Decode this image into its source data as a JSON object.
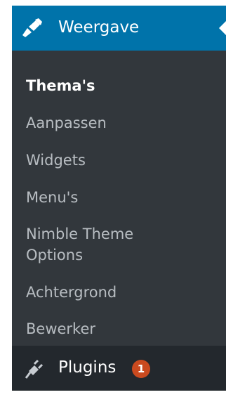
{
  "menu": {
    "section_label": "Weergave",
    "section_icon": "paintbrush-icon",
    "colors": {
      "active_bg": "#0073aa",
      "sidebar_bg": "#32373c",
      "item_bg": "#23282d",
      "badge_bg": "#ca4a1f",
      "text": "#ffffff"
    },
    "submenu": [
      {
        "label": "Thema's",
        "current": true
      },
      {
        "label": "Aanpassen"
      },
      {
        "label": "Widgets"
      },
      {
        "label": "Menu's"
      },
      {
        "label": "Nimble Theme"
      },
      {
        "label": "Options"
      },
      {
        "label": "Achtergrond"
      },
      {
        "label": "Bewerker"
      }
    ],
    "plugins": {
      "label": "Plugins",
      "icon": "plug-icon",
      "badge": "1"
    }
  }
}
